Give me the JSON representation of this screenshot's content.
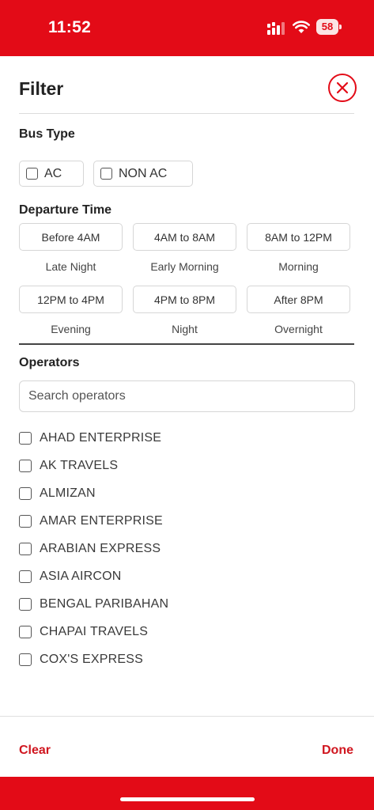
{
  "status_bar": {
    "time": "11:52",
    "battery": "58"
  },
  "header": {
    "title": "Filter"
  },
  "bus_type": {
    "title": "Bus Type",
    "options": [
      "AC",
      "NON AC"
    ]
  },
  "departure": {
    "title": "Departure Time",
    "slots": [
      {
        "time": "Before 4AM",
        "label": "Late Night"
      },
      {
        "time": "4AM to 8AM",
        "label": "Early Morning"
      },
      {
        "time": "8AM to 12PM",
        "label": "Morning"
      },
      {
        "time": "12PM to 4PM",
        "label": "Evening"
      },
      {
        "time": "4PM to 8PM",
        "label": "Night"
      },
      {
        "time": "After 8PM",
        "label": "Overnight"
      }
    ]
  },
  "operators": {
    "title": "Operators",
    "search_placeholder": "Search operators",
    "items": [
      "AHAD ENTERPRISE",
      "AK TRAVELS",
      "ALMIZAN",
      "AMAR ENTERPRISE",
      "ARABIAN EXPRESS",
      "ASIA AIRCON",
      "BENGAL PARIBAHAN",
      "CHAPAI TRAVELS",
      "COX'S EXPRESS"
    ]
  },
  "footer": {
    "clear_label": "Clear",
    "done_label": "Done"
  },
  "colors": {
    "brand_red": "#e30b17",
    "link_red": "#d0161f"
  },
  "icons": {
    "close": "close-circle-icon",
    "checkbox": "checkbox-unchecked-icon"
  }
}
